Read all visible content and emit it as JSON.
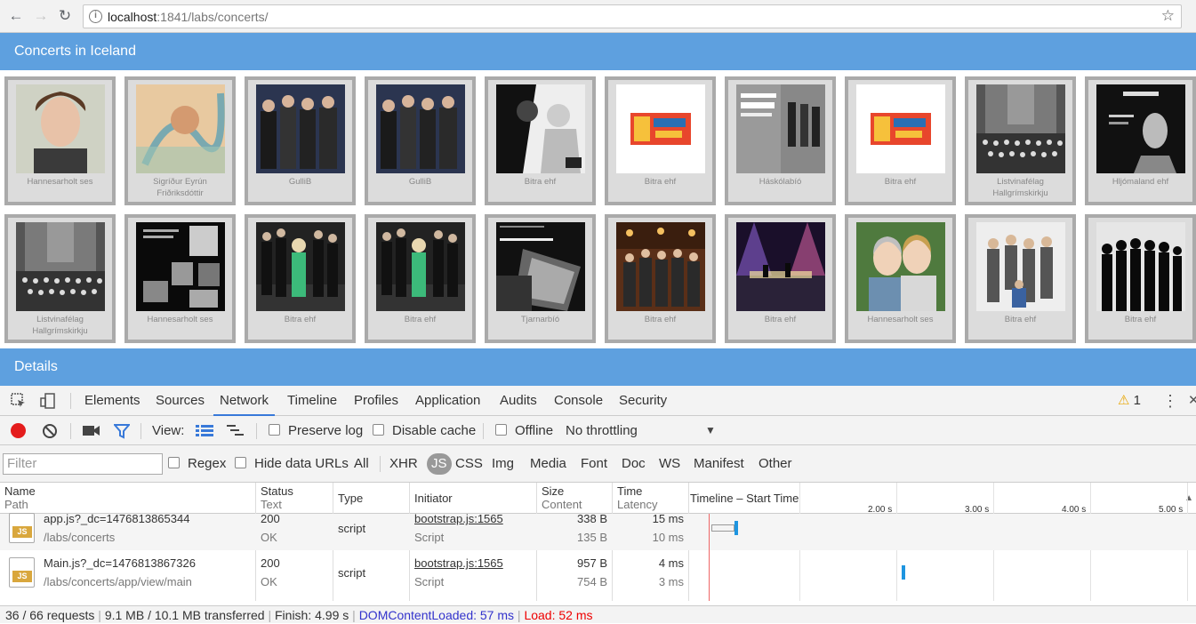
{
  "browser": {
    "url_host": "localhost",
    "url_rest": ":1841/labs/concerts/"
  },
  "concerts": {
    "title": "Concerts in Iceland",
    "items": [
      {
        "caption": "Hannesarholt ses",
        "thumb": "portrait"
      },
      {
        "caption": "Sigríður Eyrún Friðriksdóttir",
        "thumb": "artsy"
      },
      {
        "caption": "GulliB",
        "thumb": "band"
      },
      {
        "caption": "GulliB",
        "thumb": "band"
      },
      {
        "caption": "Bitra ehf",
        "thumb": "bw"
      },
      {
        "caption": "Bitra ehf",
        "thumb": "logo"
      },
      {
        "caption": "Háskólabíó",
        "thumb": "poster"
      },
      {
        "caption": "Bitra ehf",
        "thumb": "logo"
      },
      {
        "caption": "Listvinafélag Hallgrímskirkju",
        "thumb": "choir"
      },
      {
        "caption": "Hljómaland ehf",
        "thumb": "dark"
      },
      {
        "caption": "Listvinafélag Hallgrímskirkju",
        "thumb": "choir"
      },
      {
        "caption": "Hannesarholt ses",
        "thumb": "collage"
      },
      {
        "caption": "Bitra ehf",
        "thumb": "group"
      },
      {
        "caption": "Bitra ehf",
        "thumb": "group"
      },
      {
        "caption": "Tjarnarbíó",
        "thumb": "film"
      },
      {
        "caption": "Bitra ehf",
        "thumb": "pub"
      },
      {
        "caption": "Bitra ehf",
        "thumb": "stage"
      },
      {
        "caption": "Hannesarholt ses",
        "thumb": "duo"
      },
      {
        "caption": "Bitra ehf",
        "thumb": "men"
      },
      {
        "caption": "Bitra ehf",
        "thumb": "silhouette"
      }
    ]
  },
  "details": {
    "title": "Details"
  },
  "devtools": {
    "tabs": [
      "Elements",
      "Sources",
      "Network",
      "Timeline",
      "Profiles",
      "Application",
      "Audits",
      "Console",
      "Security"
    ],
    "warning_count": "1",
    "toolbar": {
      "view_label": "View:",
      "preserve_log": "Preserve log",
      "disable_cache": "Disable cache",
      "offline": "Offline",
      "throttling": "No throttling"
    },
    "filter": {
      "placeholder": "Filter",
      "regex": "Regex",
      "hide_data_urls": "Hide data URLs",
      "types": [
        "All",
        "XHR",
        "JS",
        "CSS",
        "Img",
        "Media",
        "Font",
        "Doc",
        "WS",
        "Manifest",
        "Other"
      ]
    },
    "columns": {
      "name": "Name",
      "name_sub": "Path",
      "status": "Status",
      "status_sub": "Text",
      "type": "Type",
      "initiator": "Initiator",
      "size": "Size",
      "size_sub": "Content",
      "time": "Time",
      "time_sub": "Latency",
      "timeline": "Timeline – Start Time"
    },
    "timeline_ticks": [
      "2.00 s",
      "3.00 s",
      "4.00 s",
      "5.00 s"
    ],
    "requests": [
      {
        "name": "app.js?_dc=1476813865344",
        "path": "/labs/concerts",
        "status": "200",
        "status_text": "OK",
        "type": "script",
        "initiator": "bootstrap.js:1565",
        "initiator_sub": "Script",
        "size": "338 B",
        "content": "135 B",
        "time": "15 ms",
        "latency": "10 ms"
      },
      {
        "name": "Main.js?_dc=1476813867326",
        "path": "/labs/concerts/app/view/main",
        "status": "200",
        "status_text": "OK",
        "type": "script",
        "initiator": "bootstrap.js:1565",
        "initiator_sub": "Script",
        "size": "957 B",
        "content": "754 B",
        "time": "4 ms",
        "latency": "3 ms"
      }
    ],
    "summary": {
      "requests": "36 / 66 requests",
      "transferred": "9.1 MB / 10.1 MB transferred",
      "finish": "Finish: 4.99 s",
      "dom": "DOMContentLoaded: 57 ms",
      "load": "Load: 52 ms"
    }
  }
}
